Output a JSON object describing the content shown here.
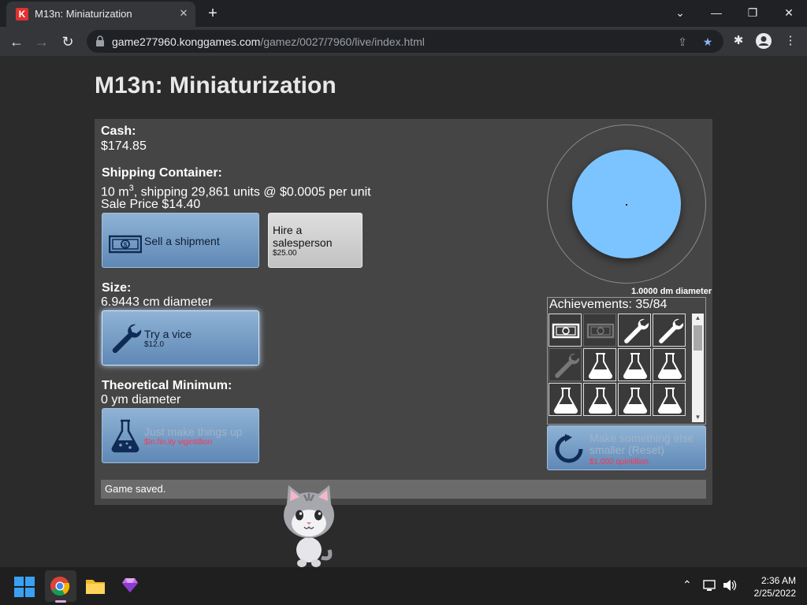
{
  "browser": {
    "tab_title": "M13n: Miniaturization",
    "favicon_letter": "K",
    "url_host": "game277960.konggames.com",
    "url_path": "/gamez/0027/7960/live/index.html"
  },
  "game": {
    "title": "M13n: Miniaturization",
    "cash_label": "Cash:",
    "cash_value": "$174.85",
    "shipping_label": "Shipping Container:",
    "shipping_line_pre": "10 m",
    "shipping_sup": "3",
    "shipping_line_post": ", shipping 29,861 units @ $0.0005 per unit",
    "sale_price": "Sale Price $14.40",
    "sell_button": {
      "label": "Sell a shipment"
    },
    "hire_button": {
      "label": "Hire a salesperson",
      "cost": "$25.00"
    },
    "size_label": "Size:",
    "size_value": "6.9443 cm diameter",
    "vice_button": {
      "label": "Try a vice",
      "cost": "$12.0"
    },
    "min_label": "Theoretical Minimum:",
    "min_value": "0 ym diameter",
    "makeup_button": {
      "label": "Just make things up",
      "cost": "$In.fin.ity vigintillion"
    },
    "diameter_caption": "1.0000 dm diameter",
    "achievements_title": "Achievements: 35/84",
    "achievements": [
      {
        "icon": "money-icon",
        "unlocked": true
      },
      {
        "icon": "money-icon",
        "unlocked": false
      },
      {
        "icon": "wrench-icon",
        "unlocked": true
      },
      {
        "icon": "wrench-icon",
        "unlocked": true
      },
      {
        "icon": "wrench-icon",
        "unlocked": false
      },
      {
        "icon": "flask-icon",
        "unlocked": true
      },
      {
        "icon": "flask-icon",
        "unlocked": true
      },
      {
        "icon": "flask-icon",
        "unlocked": true
      },
      {
        "icon": "flask-icon",
        "unlocked": true
      },
      {
        "icon": "flask-icon",
        "unlocked": true
      },
      {
        "icon": "flask-icon",
        "unlocked": true
      },
      {
        "icon": "flask-icon",
        "unlocked": true
      }
    ],
    "reset_button": {
      "label": "Make something else smaller (Reset)",
      "cost": "$1.000 quintillion"
    },
    "status": "Game saved."
  },
  "colors": {
    "ball": "#7cc4ff",
    "button_blue": "#7fa4cb",
    "disabled_cost": "#ff3355"
  },
  "taskbar": {
    "time": "2:36 AM",
    "date": "2/25/2022"
  }
}
